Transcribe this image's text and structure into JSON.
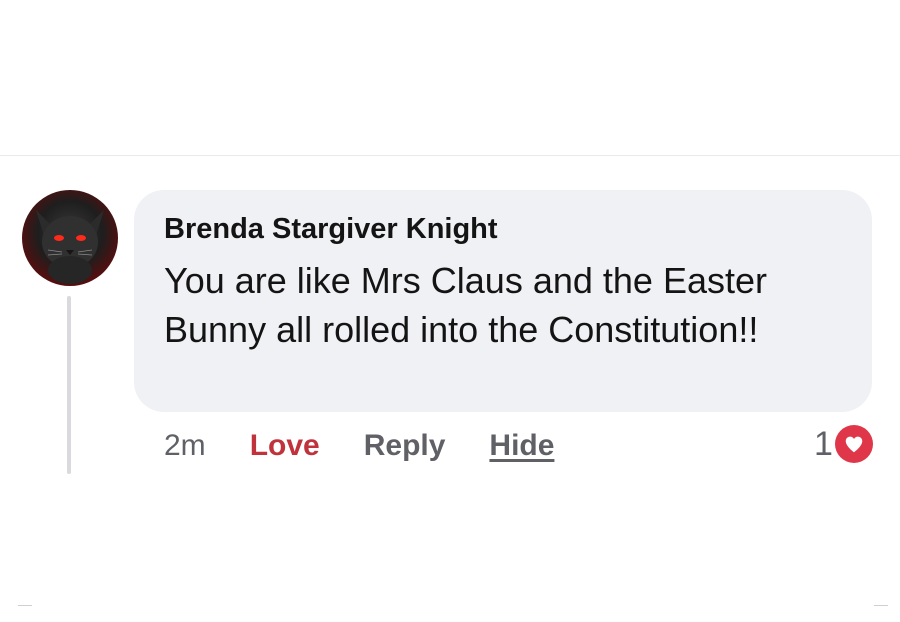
{
  "comment": {
    "author": "Brenda Stargiver Knight",
    "text": "You are like Mrs Claus and the Easter Bunny all rolled into the Constitution!!",
    "avatar_icon": "cat-avatar-icon",
    "bubble_color": "#f0f1f4"
  },
  "actions": {
    "time": "2m",
    "love_label": "Love",
    "reply_label": "Reply",
    "hide_label": "Hide",
    "love_color": "#c0333d"
  },
  "reactions": {
    "count": "1",
    "icon": "heart-icon",
    "badge_color": "#e0364a"
  }
}
